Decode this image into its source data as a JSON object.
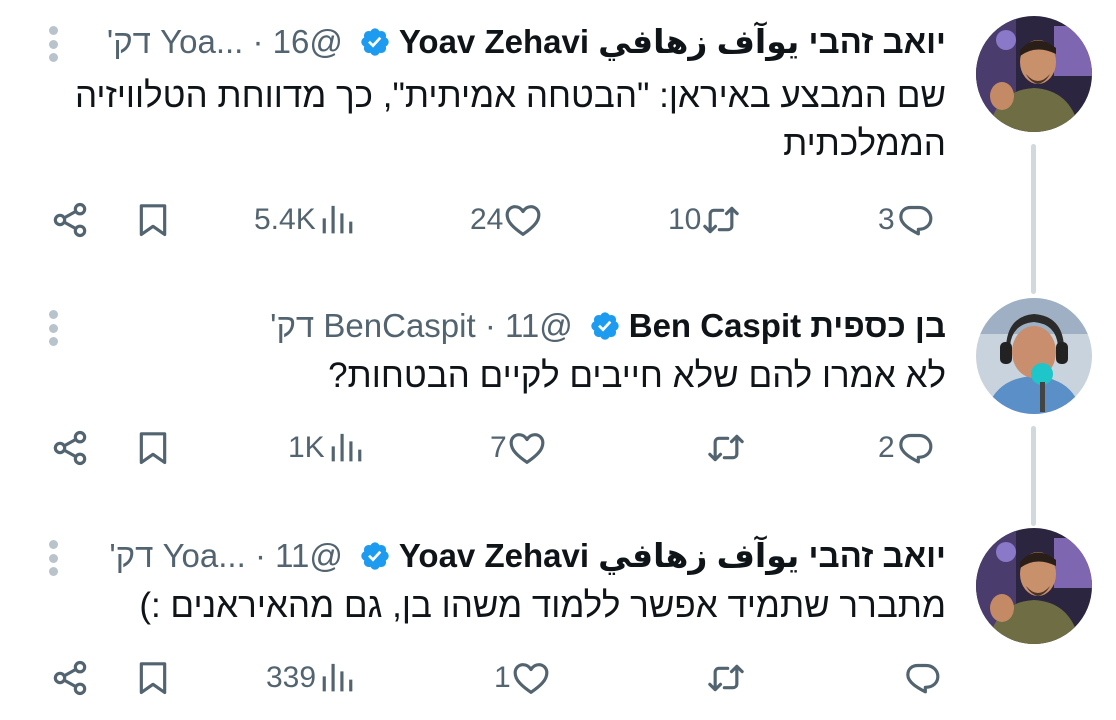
{
  "tweets": [
    {
      "display_name": "יואב זהבי يوآف زهافي Yoav Zehavi",
      "meta": "@Yoa... · 16 דק'",
      "verified": true,
      "text": "שם המבצע באיראן: \"הבטחה אמיתית\", כך מדווחת הטלוויזיה הממלכתית",
      "replies": "3",
      "retweets": "10",
      "likes": "24",
      "views": "5.4K",
      "avatar": "yoav-zehavi-avatar"
    },
    {
      "display_name": "בן כספית Ben Caspit",
      "meta": "@BenCaspit · 11 דק'",
      "verified": true,
      "text": "לא אמרו להם שלא חייבים לקיים הבטחות?",
      "replies": "2",
      "retweets": "",
      "likes": "7",
      "views": "1K",
      "avatar": "ben-caspit-avatar"
    },
    {
      "display_name": "יואב זהבי يوآف زهافي Yoav Zehavi",
      "meta": "@Yoa... · 11 דק'",
      "verified": true,
      "text": "מתברר שתמיד אפשר ללמוד משהו בן, גם מהאיראנים :)",
      "replies": "",
      "retweets": "",
      "likes": "1",
      "views": "339",
      "avatar": "yoav-zehavi-avatar"
    }
  ],
  "colors": {
    "text": "#0f1419",
    "secondary": "#536471",
    "verified": "#1d9bf0",
    "thread_line": "#cfd9de"
  },
  "icons": {
    "reply": "reply-icon",
    "retweet": "retweet-icon",
    "like": "heart-icon",
    "views": "views-icon",
    "bookmark": "bookmark-icon",
    "share": "share-icon",
    "more": "more-options-icon",
    "verified": "verified-badge-icon"
  }
}
